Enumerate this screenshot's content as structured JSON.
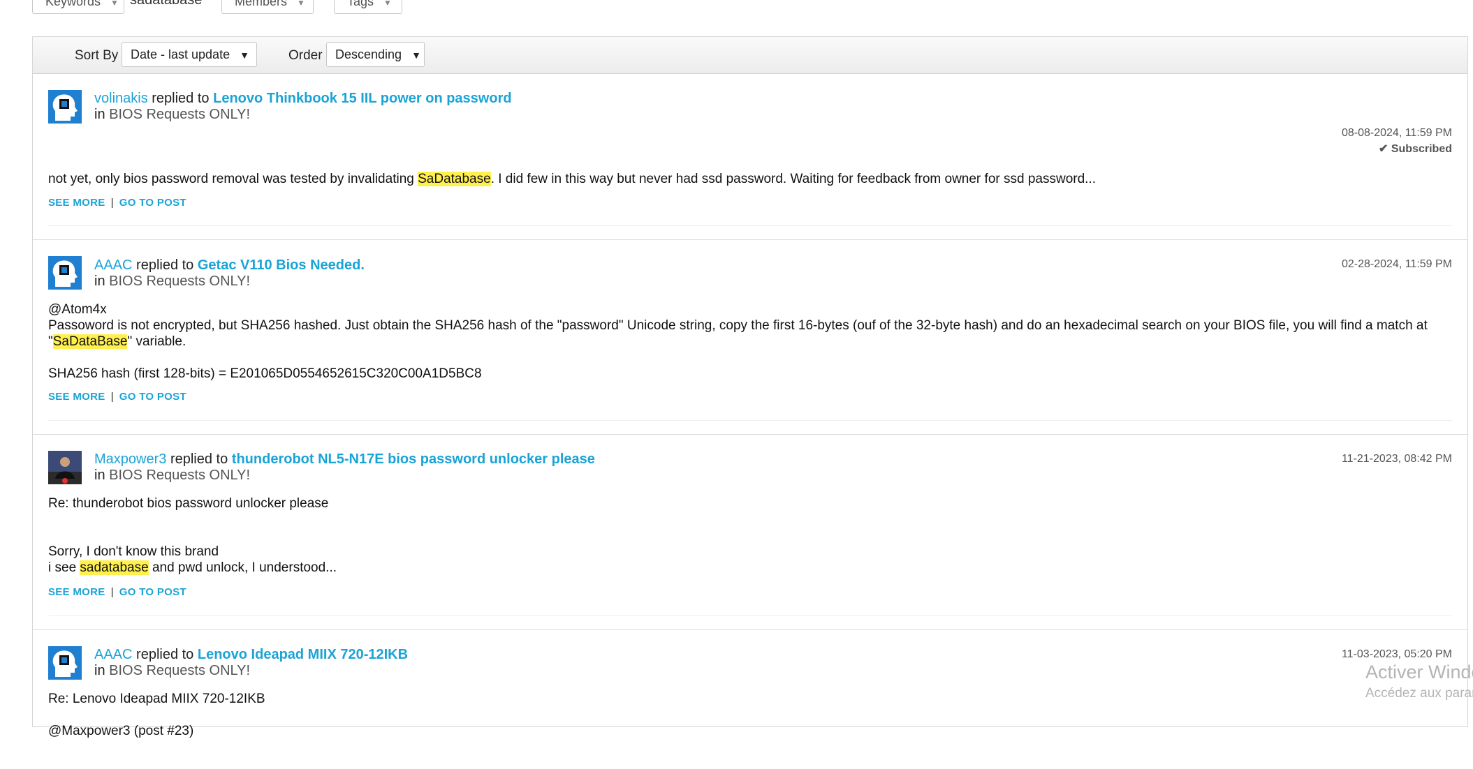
{
  "filters": {
    "keywords_label": "Keywords",
    "keywords_value": "sadatabase",
    "members_label": "Members",
    "tags_label": "Tags"
  },
  "sortbar": {
    "sort_by_label": "Sort By",
    "sort_by_value": "Date - last update",
    "order_label": "Order",
    "order_value": "Descending"
  },
  "common": {
    "replied_to": "replied to",
    "in": "in",
    "see_more": "SEE MORE",
    "go_to_post": "GO TO POST",
    "link_separator": "|"
  },
  "posts": [
    {
      "author": "volinakis",
      "thread": "Lenovo Thinkbook 15 IIL power on password",
      "board": "BIOS Requests ONLY!",
      "date": "08-08-2024, 11:59 PM",
      "subscribed": "Subscribed",
      "body": {
        "p1_before": "not yet, only bios password removal was tested by invalidating ",
        "p1_highlight": "SaDatabase",
        "p1_after": ". I did few in this way but never had ssd password. Waiting for feedback from owner for ssd password..."
      }
    },
    {
      "author": "AAAC",
      "thread": "Getac V110 Bios Needed.",
      "board": "BIOS Requests ONLY!",
      "date": "02-28-2024, 11:59 PM",
      "body": {
        "line1": "@Atom4x",
        "line2_before": "Passoword is not encrypted, but SHA256 hashed. Just obtain the SHA256 hash of the \"password\" Unicode string, copy the first 16-bytes (ouf of the 32-byte hash) and do an hexadecimal search on your BIOS file, you will find a match at \"",
        "line2_highlight": "SaDataBase",
        "line2_after": "\" variable.",
        "line3": "SHA256 hash (first 128-bits) = E201065D0554652615C320C00A1D5BC8"
      }
    },
    {
      "author": "Maxpower3",
      "thread": "thunderobot NL5-N17E bios password unlocker please",
      "board": "BIOS Requests ONLY!",
      "date": "11-21-2023, 08:42 PM",
      "body": {
        "line1": "Re: thunderobot bios password unlocker please",
        "line2": "Sorry, I don't know this brand",
        "line3_before": "i see ",
        "line3_highlight": "sadatabase",
        "line3_after": " and pwd unlock, I understood..."
      }
    },
    {
      "author": "AAAC",
      "thread": "Lenovo Ideapad MIIX 720-12IKB",
      "board": "BIOS Requests ONLY!",
      "date": "11-03-2023, 05:20 PM",
      "body": {
        "line1": "Re: Lenovo Ideapad MIIX 720-12IKB",
        "line2": "@Maxpower3 (post #23)"
      }
    }
  ],
  "watermark": {
    "line1": "Activer Windows",
    "line2": "Accédez aux paramètres"
  }
}
